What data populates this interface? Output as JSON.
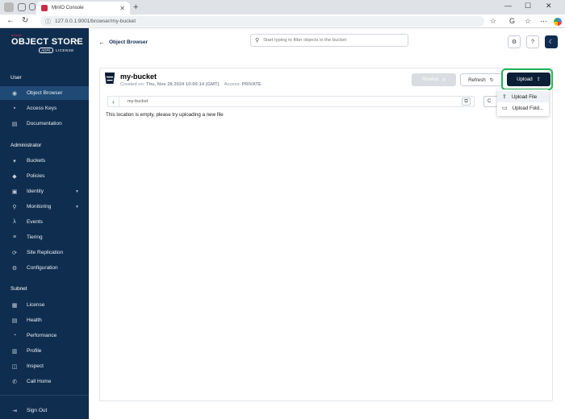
{
  "browser": {
    "tab_title": "MinIO Console",
    "url": "127.0.0.1:9001/browser/my-bucket"
  },
  "sidebar": {
    "logo": {
      "brand": "minio",
      "product": "OBJECT STORE",
      "edition": "AGPL",
      "license": "LICENSE"
    },
    "sections": {
      "user": "User",
      "administrator": "Administrator",
      "subnet": "Subnet"
    },
    "user_items": [
      {
        "label": "Object Browser",
        "icon": "object-browser-icon"
      },
      {
        "label": "Access Keys",
        "icon": "key-icon"
      },
      {
        "label": "Documentation",
        "icon": "document-icon"
      }
    ],
    "admin_items": [
      {
        "label": "Buckets",
        "icon": "bucket-icon"
      },
      {
        "label": "Policies",
        "icon": "shield-icon"
      },
      {
        "label": "Identity",
        "icon": "identity-icon",
        "expandable": true
      },
      {
        "label": "Monitoring",
        "icon": "magnifier-icon",
        "expandable": true
      },
      {
        "label": "Events",
        "icon": "lambda-icon"
      },
      {
        "label": "Tiering",
        "icon": "tiers-icon"
      },
      {
        "label": "Site Replication",
        "icon": "replication-icon"
      },
      {
        "label": "Configuration",
        "icon": "gear-icon"
      }
    ],
    "subnet_items": [
      {
        "label": "License",
        "icon": "license-icon"
      },
      {
        "label": "Health",
        "icon": "health-icon"
      },
      {
        "label": "Performance",
        "icon": "speedometer-icon"
      },
      {
        "label": "Profile",
        "icon": "profile-icon"
      },
      {
        "label": "Inspect",
        "icon": "inspect-icon"
      },
      {
        "label": "Call Home",
        "icon": "phone-icon"
      }
    ],
    "sign_out": "Sign Out"
  },
  "header": {
    "back_label": "Object Browser",
    "search_placeholder": "Start typing to filter objects in the bucket"
  },
  "bucket": {
    "name": "my-bucket",
    "created_label": "Created on:",
    "created_value": "Thu, Nov 28 2024 10:00:14 (GMT)",
    "access_label": "Access:",
    "access_value": "PRIVATE",
    "rewind_label": "Rewind",
    "refresh_label": "Refresh",
    "upload_label": "Upload",
    "path": "my-bucket",
    "create_label": "C",
    "empty_message": "This location is empty, please try uploading a new file"
  },
  "upload_menu": {
    "file_label": "Upload File",
    "folder_label": "Upload Fold..."
  },
  "colors": {
    "sidebar_bg": "#0f2d4f",
    "sidebar_active": "#1f4a75",
    "upload_button": "#0b1f36",
    "highlight": "#22b455",
    "brand": "#c72e49"
  }
}
